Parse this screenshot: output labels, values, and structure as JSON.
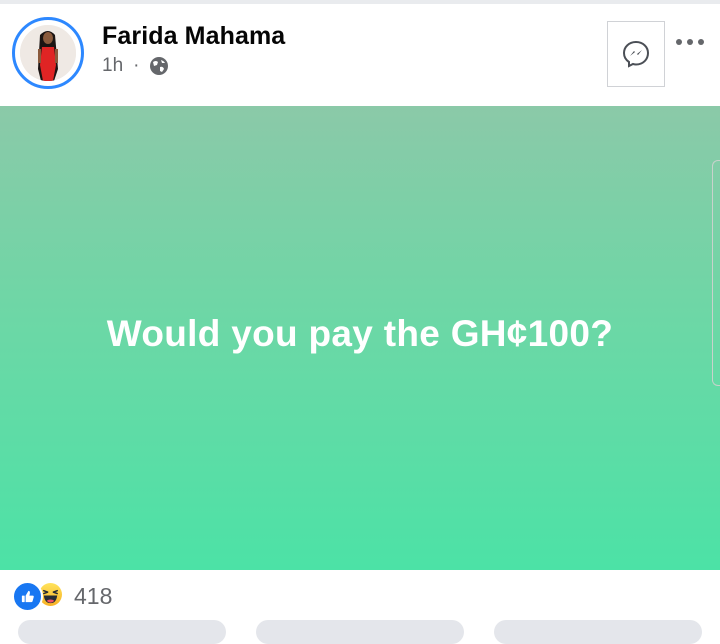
{
  "post": {
    "author": "Farida Mahama",
    "time": "1h",
    "separator": "·",
    "text": "Would you pay the GH¢100?"
  },
  "reactions": {
    "count": "418"
  },
  "icons": {
    "privacy": "globe-icon",
    "messenger": "messenger-icon",
    "more": "more-dots-icon",
    "like": "like-reaction-icon",
    "haha": "haha-reaction-icon"
  },
  "colors": {
    "accent": "#1877f2",
    "avatar_ring": "#2d88ff",
    "post_gradient_top": "#8bc9a8",
    "post_gradient_bottom": "#4ce2a6",
    "post_text": "#ffffff",
    "secondary_text": "#65676b"
  }
}
